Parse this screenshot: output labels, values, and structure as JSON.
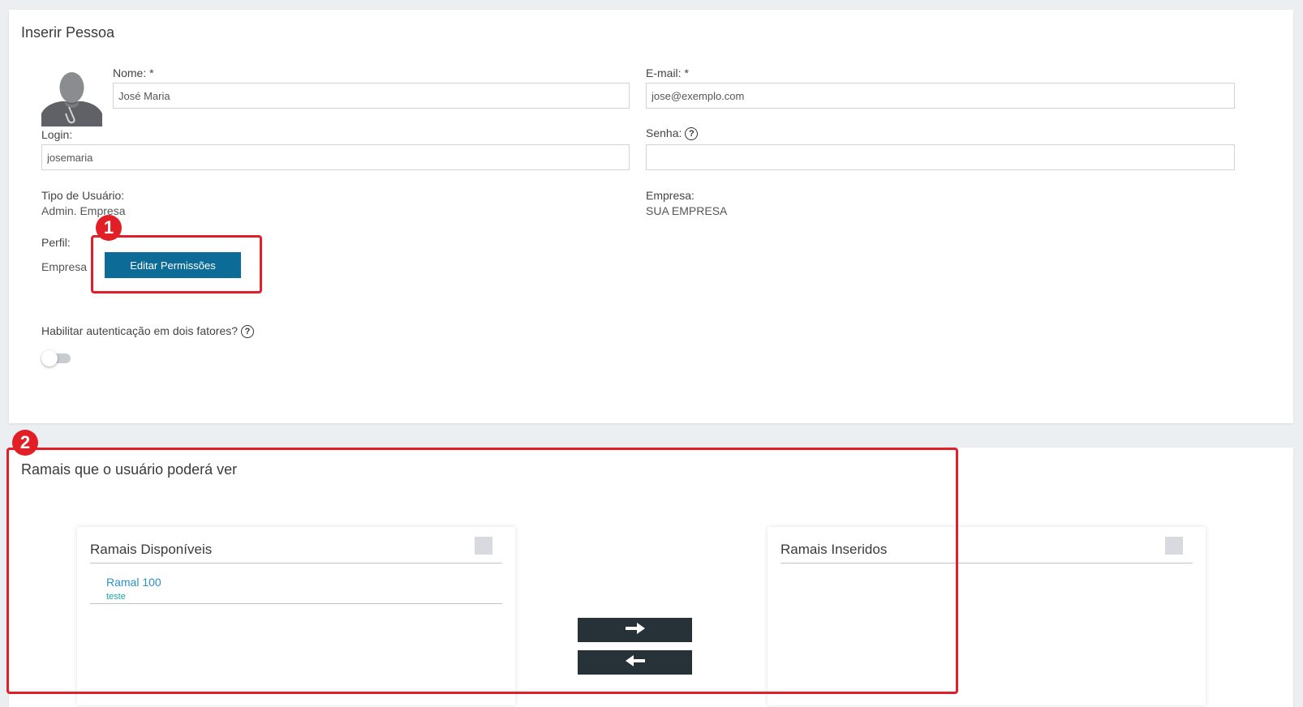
{
  "form": {
    "title": "Inserir Pessoa",
    "nome_label": "Nome: *",
    "nome_value": "José Maria",
    "email_label": "E-mail: *",
    "email_value": "jose@exemplo.com",
    "login_label": "Login:",
    "login_value": "josemaria",
    "senha_label": "Senha:",
    "senha_value": "",
    "tipo_label": "Tipo de Usuário:",
    "tipo_value": "Admin. Empresa",
    "empresa_label": "Empresa:",
    "empresa_value": "SUA EMPRESA",
    "perfil_label": "Perfil:",
    "perfil_value": "Empresa",
    "edit_permissions_button": "Editar Permissões",
    "two_factor_label": "Habilitar autenticação em dois fatores?",
    "two_factor_enabled": false,
    "help_glyph": "?"
  },
  "ramais": {
    "title": "Ramais que o usuário poderá ver",
    "available_title": "Ramais Disponíveis",
    "inserted_title": "Ramais Inseridos",
    "available_items": [
      {
        "name": "Ramal 100",
        "sub": "teste"
      }
    ],
    "move_right_icon": "arrow-right-icon",
    "move_left_icon": "arrow-left-icon"
  },
  "annotations": {
    "badge1": "1",
    "badge2": "2",
    "color": "#e21f26"
  },
  "colors": {
    "primary_button": "#0d6c97",
    "arrow_button": "#263238",
    "link": "#2a8fc9",
    "sub_text": "#1aa6a0"
  }
}
